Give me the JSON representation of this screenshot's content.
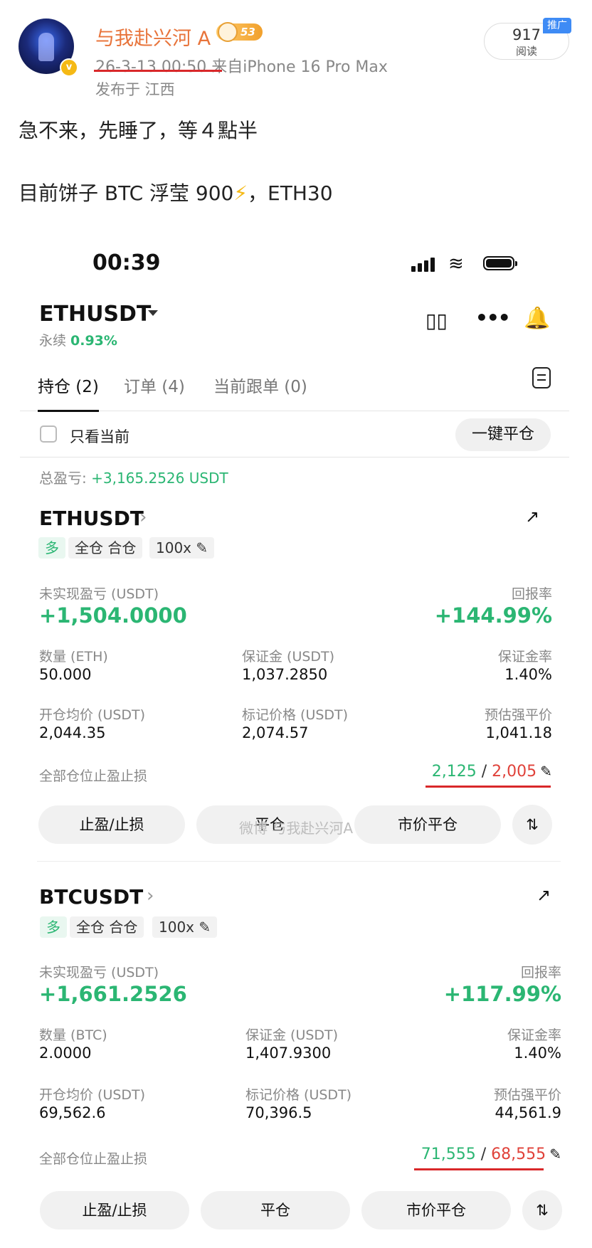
{
  "post": {
    "username": "与我赴兴河 A",
    "level": "53",
    "datetime": "26-3-13 00:50",
    "source": "来自iPhone 16 Pro Max",
    "location": "发布于 江西",
    "views_count": "917",
    "views_label": "阅读",
    "promo_badge": "推广",
    "line1": "急不来，先睡了，等４點半",
    "line2_pre": "目前饼子 BTC 浮莹 900",
    "line2_emoji": "⚡",
    "line2_post": "，ETH30"
  },
  "phone": {
    "time": "00:39",
    "pair": "ETHUSDT",
    "perp_label": "永续",
    "perp_change": "0.93%",
    "tabs": [
      "持仓 (2)",
      "订单 (4)",
      "当前跟单 (0)"
    ],
    "only_current": "只看当前",
    "close_all": "一键平仓",
    "total_pnl_label": "总盈亏:",
    "total_pnl_value": "+3,165.2526 USDT",
    "watermark": "微博 与我赴兴河A"
  },
  "positions": [
    {
      "symbol": "ETHUSDT",
      "side": "多",
      "margin_mode": "全仓 合仓",
      "leverage": "100x",
      "pnl_label": "未实现盈亏 (USDT)",
      "pnl_value": "+1,504.0000",
      "roe_label": "回报率",
      "roe_value": "+144.99%",
      "qty_label": "数量 (ETH)",
      "qty_value": "50.000",
      "margin_label": "保证金 (USDT)",
      "margin_value": "1,037.2850",
      "margin_ratio_label": "保证金率",
      "margin_ratio_value": "1.40%",
      "entry_label": "开仓均价 (USDT)",
      "entry_value": "2,044.35",
      "mark_label": "标记价格 (USDT)",
      "mark_value": "2,074.57",
      "liq_label": "预估强平价",
      "liq_value": "1,041.18",
      "tpsl_label": "全部仓位止盈止损",
      "tp_value": "2,125",
      "sl_value": "2,005",
      "btn_tpsl": "止盈/止损",
      "btn_close": "平仓",
      "btn_market_close": "市价平仓"
    },
    {
      "symbol": "BTCUSDT",
      "side": "多",
      "margin_mode": "全仓 合仓",
      "leverage": "100x",
      "pnl_label": "未实现盈亏 (USDT)",
      "pnl_value": "+1,661.2526",
      "roe_label": "回报率",
      "roe_value": "+117.99%",
      "qty_label": "数量 (BTC)",
      "qty_value": "2.0000",
      "margin_label": "保证金 (USDT)",
      "margin_value": "1,407.9300",
      "margin_ratio_label": "保证金率",
      "margin_ratio_value": "1.40%",
      "entry_label": "开仓均价 (USDT)",
      "entry_value": "69,562.6",
      "mark_label": "标记价格 (USDT)",
      "mark_value": "70,396.5",
      "liq_label": "预估强平价",
      "liq_value": "44,561.9",
      "tpsl_label": "全部仓位止盈止损",
      "tp_value": "71,555",
      "sl_value": "68,555",
      "btn_tpsl": "止盈/止损",
      "btn_close": "平仓",
      "btn_market_close": "市价平仓"
    }
  ]
}
